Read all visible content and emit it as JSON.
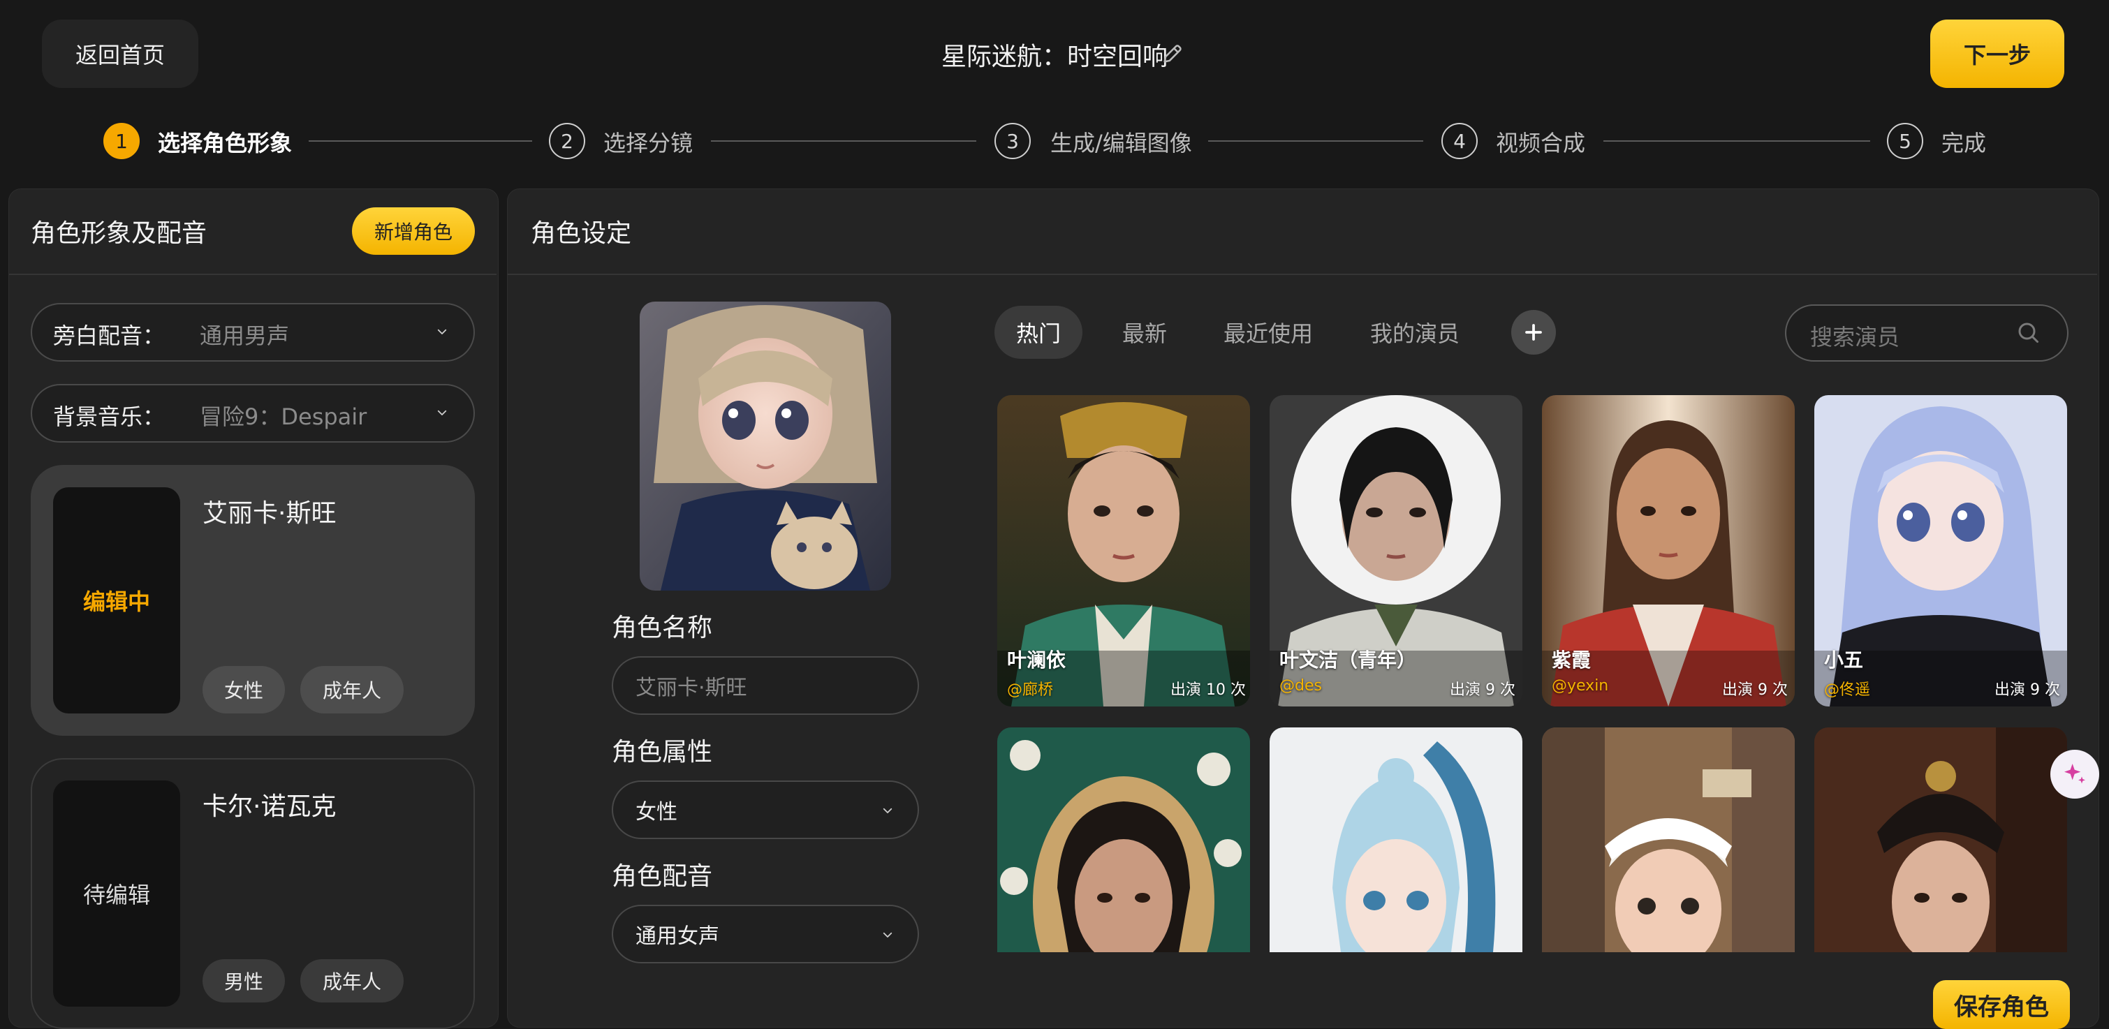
{
  "header": {
    "back_label": "返回首页",
    "project_title": "星际迷航：时空回响",
    "next_label": "下一步"
  },
  "steps": [
    {
      "num": "1",
      "label": "选择角色形象",
      "active": true
    },
    {
      "num": "2",
      "label": "选择分镜",
      "active": false
    },
    {
      "num": "3",
      "label": "生成/编辑图像",
      "active": false
    },
    {
      "num": "4",
      "label": "视频合成",
      "active": false
    },
    {
      "num": "5",
      "label": "完成",
      "active": false
    }
  ],
  "left_panel": {
    "title": "角色形象及配音",
    "add_role_label": "新增角色",
    "narration": {
      "label": "旁白配音：",
      "value": "通用男声"
    },
    "bgm": {
      "label": "背景音乐：",
      "value": "冒险9：Despair"
    },
    "roles": [
      {
        "name": "艾丽卡·斯旺",
        "status": "编辑中",
        "status_color": "#f6a800",
        "tags": [
          "女性",
          "成年人"
        ]
      },
      {
        "name": "卡尔·诺瓦克",
        "status": "待编辑",
        "status_color": "#dcdcdc",
        "tags": [
          "男性",
          "成年人"
        ]
      }
    ]
  },
  "right_panel": {
    "title": "角色设定",
    "name_label": "角色名称",
    "name_placeholder": "艾丽卡·斯旺",
    "attr_label": "角色属性",
    "attr_value": "女性",
    "voice_label": "角色配音",
    "voice_value": "通用女声",
    "tabs": [
      "热门",
      "最新",
      "最近使用",
      "我的演员"
    ],
    "search_placeholder": "搜索演员",
    "actors": [
      {
        "name": "叶澜依",
        "handle": "@廊桥",
        "count": "出演 10 次"
      },
      {
        "name": "叶文洁（青年）",
        "handle": "@des",
        "count": "出演 9 次"
      },
      {
        "name": "紫霞",
        "handle": "@yexin",
        "count": "出演 9 次"
      },
      {
        "name": "小五",
        "handle": "@佟遥",
        "count": "出演 9 次"
      }
    ],
    "save_label": "保存角色"
  },
  "colors": {
    "accent": "#f6a800",
    "background": "#181818",
    "panel": "#242424"
  }
}
